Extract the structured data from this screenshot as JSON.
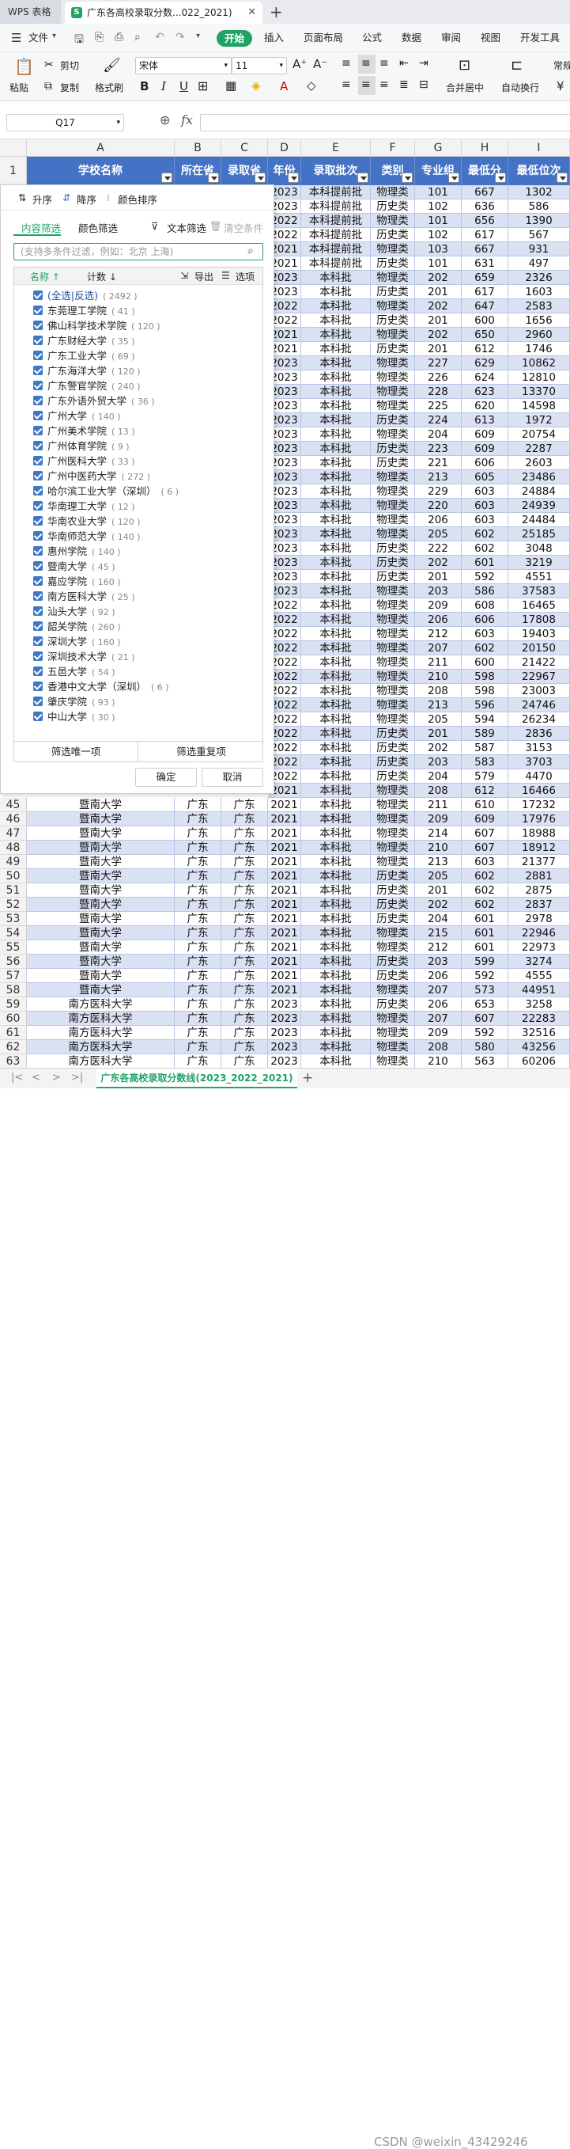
{
  "app": {
    "name": "WPS 表格",
    "doc_tab": "广东各高校录取分数...022_2021)"
  },
  "menus": [
    "文件",
    "开始",
    "插入",
    "页面布局",
    "公式",
    "数据",
    "审阅",
    "视图",
    "开发工具"
  ],
  "ribbon": {
    "paste": "粘贴",
    "cut": "剪切",
    "copy": "复制",
    "format_painter": "格式刷",
    "font": "宋体",
    "size": "11",
    "merge": "合并居中",
    "wrap": "自动换行",
    "normal": "常规",
    "currency": "¥"
  },
  "formula": {
    "cell_ref": "Q17",
    "fx": "fx",
    "value": ""
  },
  "columns": [
    "A",
    "B",
    "C",
    "D",
    "E",
    "F",
    "G",
    "H",
    "I"
  ],
  "header_row": {
    "num": "1",
    "cells": [
      "学校名称",
      "所在省",
      "录取省",
      "年份",
      "录取批次",
      "类别",
      "专业组",
      "最低分",
      "最低位次"
    ]
  },
  "filter_panel": {
    "sort_asc": "升序",
    "sort_desc": "降序",
    "color_sort": "颜色排序",
    "tab_content": "内容筛选",
    "tab_color": "颜色筛选",
    "text_filter": "文本筛选",
    "clear": "清空条件",
    "search_placeholder": "(支持多条件过滤，例如：北京 上海)",
    "list_name": "名称",
    "list_count": "计数",
    "export": "导出",
    "options": "选项",
    "select_all": "(全选|反选)",
    "select_all_count": "( 2492 )",
    "items": [
      {
        "name": "东莞理工学院",
        "count": "( 41 )"
      },
      {
        "name": "佛山科学技术学院",
        "count": "( 120 )"
      },
      {
        "name": "广东财经大学",
        "count": "( 35 )"
      },
      {
        "name": "广东工业大学",
        "count": "( 69 )"
      },
      {
        "name": "广东海洋大学",
        "count": "( 120 )"
      },
      {
        "name": "广东警官学院",
        "count": "( 240 )"
      },
      {
        "name": "广东外语外贸大学",
        "count": "( 36 )"
      },
      {
        "name": "广州大学",
        "count": "( 140 )"
      },
      {
        "name": "广州美术学院",
        "count": "( 13 )"
      },
      {
        "name": "广州体育学院",
        "count": "( 9 )"
      },
      {
        "name": "广州医科大学",
        "count": "( 33 )"
      },
      {
        "name": "广州中医药大学",
        "count": "( 272 )"
      },
      {
        "name": "哈尔滨工业大学（深圳）",
        "count": "( 6 )"
      },
      {
        "name": "华南理工大学",
        "count": "( 12 )"
      },
      {
        "name": "华南农业大学",
        "count": "( 120 )"
      },
      {
        "name": "华南师范大学",
        "count": "( 140 )"
      },
      {
        "name": "惠州学院",
        "count": "( 140 )"
      },
      {
        "name": "暨南大学",
        "count": "( 45 )"
      },
      {
        "name": "嘉应学院",
        "count": "( 160 )"
      },
      {
        "name": "南方医科大学",
        "count": "( 25 )"
      },
      {
        "name": "汕头大学",
        "count": "( 92 )"
      },
      {
        "name": "韶关学院",
        "count": "( 260 )"
      },
      {
        "name": "深圳大学",
        "count": "( 160 )"
      },
      {
        "name": "深圳技术大学",
        "count": "( 21 )"
      },
      {
        "name": "五邑大学",
        "count": "( 54 )"
      },
      {
        "name": "香港中文大学（深圳）",
        "count": "( 6 )"
      },
      {
        "name": "肇庆学院",
        "count": "( 93 )"
      },
      {
        "name": "中山大学",
        "count": "( 30 )"
      }
    ],
    "unique": "筛选唯一项",
    "dup": "筛选重复项",
    "ok": "确定",
    "cancel": "取消"
  },
  "right_rows": [
    [
      "2023",
      "本科提前批",
      "物理类",
      "101",
      "667",
      "1302"
    ],
    [
      "2023",
      "本科提前批",
      "历史类",
      "102",
      "636",
      "586"
    ],
    [
      "2022",
      "本科提前批",
      "物理类",
      "101",
      "656",
      "1390"
    ],
    [
      "2022",
      "本科提前批",
      "历史类",
      "102",
      "617",
      "567"
    ],
    [
      "2021",
      "本科提前批",
      "物理类",
      "103",
      "667",
      "931"
    ],
    [
      "2021",
      "本科提前批",
      "历史类",
      "101",
      "631",
      "497"
    ],
    [
      "2023",
      "本科批",
      "物理类",
      "202",
      "659",
      "2326"
    ],
    [
      "2023",
      "本科批",
      "历史类",
      "201",
      "617",
      "1603"
    ],
    [
      "2022",
      "本科批",
      "物理类",
      "202",
      "647",
      "2583"
    ],
    [
      "2022",
      "本科批",
      "历史类",
      "201",
      "600",
      "1656"
    ],
    [
      "2021",
      "本科批",
      "物理类",
      "202",
      "650",
      "2960"
    ],
    [
      "2021",
      "本科批",
      "历史类",
      "201",
      "612",
      "1746"
    ],
    [
      "2023",
      "本科批",
      "物理类",
      "227",
      "629",
      "10862"
    ],
    [
      "2023",
      "本科批",
      "物理类",
      "226",
      "624",
      "12810"
    ],
    [
      "2023",
      "本科批",
      "物理类",
      "228",
      "623",
      "13370"
    ],
    [
      "2023",
      "本科批",
      "物理类",
      "225",
      "620",
      "14598"
    ],
    [
      "2023",
      "本科批",
      "历史类",
      "224",
      "613",
      "1972"
    ],
    [
      "2023",
      "本科批",
      "物理类",
      "204",
      "609",
      "20754"
    ],
    [
      "2023",
      "本科批",
      "历史类",
      "223",
      "609",
      "2287"
    ],
    [
      "2023",
      "本科批",
      "历史类",
      "221",
      "606",
      "2603"
    ],
    [
      "2023",
      "本科批",
      "物理类",
      "213",
      "605",
      "23486"
    ],
    [
      "2023",
      "本科批",
      "物理类",
      "229",
      "603",
      "24884"
    ],
    [
      "2023",
      "本科批",
      "物理类",
      "220",
      "603",
      "24939"
    ],
    [
      "2023",
      "本科批",
      "物理类",
      "206",
      "603",
      "24484"
    ],
    [
      "2023",
      "本科批",
      "物理类",
      "205",
      "602",
      "25185"
    ],
    [
      "2023",
      "本科批",
      "历史类",
      "222",
      "602",
      "3048"
    ],
    [
      "2023",
      "本科批",
      "历史类",
      "202",
      "601",
      "3219"
    ],
    [
      "2023",
      "本科批",
      "历史类",
      "201",
      "592",
      "4551"
    ],
    [
      "2023",
      "本科批",
      "物理类",
      "203",
      "586",
      "37583"
    ],
    [
      "2022",
      "本科批",
      "物理类",
      "209",
      "608",
      "16465"
    ],
    [
      "2022",
      "本科批",
      "物理类",
      "206",
      "606",
      "17808"
    ],
    [
      "2022",
      "本科批",
      "物理类",
      "212",
      "603",
      "19403"
    ],
    [
      "2022",
      "本科批",
      "物理类",
      "207",
      "602",
      "20150"
    ],
    [
      "2022",
      "本科批",
      "物理类",
      "211",
      "600",
      "21422"
    ],
    [
      "2022",
      "本科批",
      "物理类",
      "210",
      "598",
      "22967"
    ],
    [
      "2022",
      "本科批",
      "物理类",
      "208",
      "598",
      "23003"
    ],
    [
      "2022",
      "本科批",
      "物理类",
      "213",
      "596",
      "24746"
    ],
    [
      "2022",
      "本科批",
      "物理类",
      "205",
      "594",
      "26234"
    ],
    [
      "2022",
      "本科批",
      "历史类",
      "201",
      "589",
      "2836"
    ],
    [
      "2022",
      "本科批",
      "历史类",
      "202",
      "587",
      "3153"
    ],
    [
      "2022",
      "本科批",
      "历史类",
      "203",
      "583",
      "3703"
    ],
    [
      "2022",
      "本科批",
      "历史类",
      "204",
      "579",
      "4470"
    ],
    [
      "2021",
      "本科批",
      "物理类",
      "208",
      "612",
      "16466"
    ]
  ],
  "full_rows": [
    [
      "45",
      "暨南大学",
      "广东",
      "广东",
      "2021",
      "本科批",
      "物理类",
      "211",
      "610",
      "17232"
    ],
    [
      "46",
      "暨南大学",
      "广东",
      "广东",
      "2021",
      "本科批",
      "物理类",
      "209",
      "609",
      "17976"
    ],
    [
      "47",
      "暨南大学",
      "广东",
      "广东",
      "2021",
      "本科批",
      "物理类",
      "214",
      "607",
      "18988"
    ],
    [
      "48",
      "暨南大学",
      "广东",
      "广东",
      "2021",
      "本科批",
      "物理类",
      "210",
      "607",
      "18912"
    ],
    [
      "49",
      "暨南大学",
      "广东",
      "广东",
      "2021",
      "本科批",
      "物理类",
      "213",
      "603",
      "21377"
    ],
    [
      "50",
      "暨南大学",
      "广东",
      "广东",
      "2021",
      "本科批",
      "历史类",
      "205",
      "602",
      "2881"
    ],
    [
      "51",
      "暨南大学",
      "广东",
      "广东",
      "2021",
      "本科批",
      "历史类",
      "201",
      "602",
      "2875"
    ],
    [
      "52",
      "暨南大学",
      "广东",
      "广东",
      "2021",
      "本科批",
      "历史类",
      "202",
      "602",
      "2837"
    ],
    [
      "53",
      "暨南大学",
      "广东",
      "广东",
      "2021",
      "本科批",
      "历史类",
      "204",
      "601",
      "2978"
    ],
    [
      "54",
      "暨南大学",
      "广东",
      "广东",
      "2021",
      "本科批",
      "物理类",
      "215",
      "601",
      "22946"
    ],
    [
      "55",
      "暨南大学",
      "广东",
      "广东",
      "2021",
      "本科批",
      "物理类",
      "212",
      "601",
      "22973"
    ],
    [
      "56",
      "暨南大学",
      "广东",
      "广东",
      "2021",
      "本科批",
      "历史类",
      "203",
      "599",
      "3274"
    ],
    [
      "57",
      "暨南大学",
      "广东",
      "广东",
      "2021",
      "本科批",
      "历史类",
      "206",
      "592",
      "4555"
    ],
    [
      "58",
      "暨南大学",
      "广东",
      "广东",
      "2021",
      "本科批",
      "物理类",
      "207",
      "573",
      "44951"
    ],
    [
      "59",
      "南方医科大学",
      "广东",
      "广东",
      "2023",
      "本科批",
      "历史类",
      "206",
      "653",
      "3258"
    ],
    [
      "60",
      "南方医科大学",
      "广东",
      "广东",
      "2023",
      "本科批",
      "物理类",
      "207",
      "607",
      "22283"
    ],
    [
      "61",
      "南方医科大学",
      "广东",
      "广东",
      "2023",
      "本科批",
      "物理类",
      "209",
      "592",
      "32516"
    ],
    [
      "62",
      "南方医科大学",
      "广东",
      "广东",
      "2023",
      "本科批",
      "物理类",
      "208",
      "580",
      "43256"
    ],
    [
      "63",
      "南方医科大学",
      "广东",
      "广东",
      "2023",
      "本科批",
      "物理类",
      "210",
      "563",
      "60206"
    ]
  ],
  "sheet_tab": "广东各高校录取分数线(2023_2022_2021)",
  "watermark": "CSDN @weixin_43429246"
}
